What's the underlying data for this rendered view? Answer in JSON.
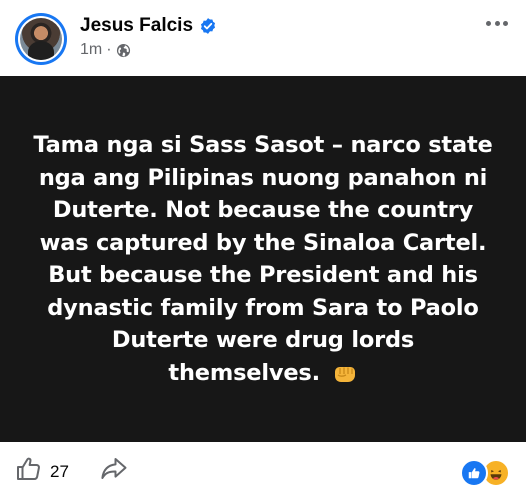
{
  "post": {
    "author_name": "Jesus Falcis",
    "time": "1m",
    "separator": "·",
    "privacy_icon": "globe-icon",
    "verified_icon": "verified-badge-icon",
    "avatar": "profile-photo",
    "body_text": "Tama nga si Sass Sasot – narco state nga ang Pilipinas nuong panahon ni Duterte. Not because the country was captured by the Sinaloa Cartel. But because the President and his dynastic family from Sara to Paolo Duterte were drug lords themselves.",
    "body_emoji": "oncoming-fist-emoji",
    "background_color": "#171717",
    "text_color": "#ffffff"
  },
  "footer": {
    "like_icon": "thumbs-up-outline-icon",
    "like_count": "27",
    "share_icon": "share-arrow-icon",
    "reactions": [
      "like-reaction-icon",
      "haha-reaction-icon"
    ]
  },
  "colors": {
    "accent": "#1877f2",
    "secondary_text": "#65676b",
    "haha": "#f7b125"
  }
}
